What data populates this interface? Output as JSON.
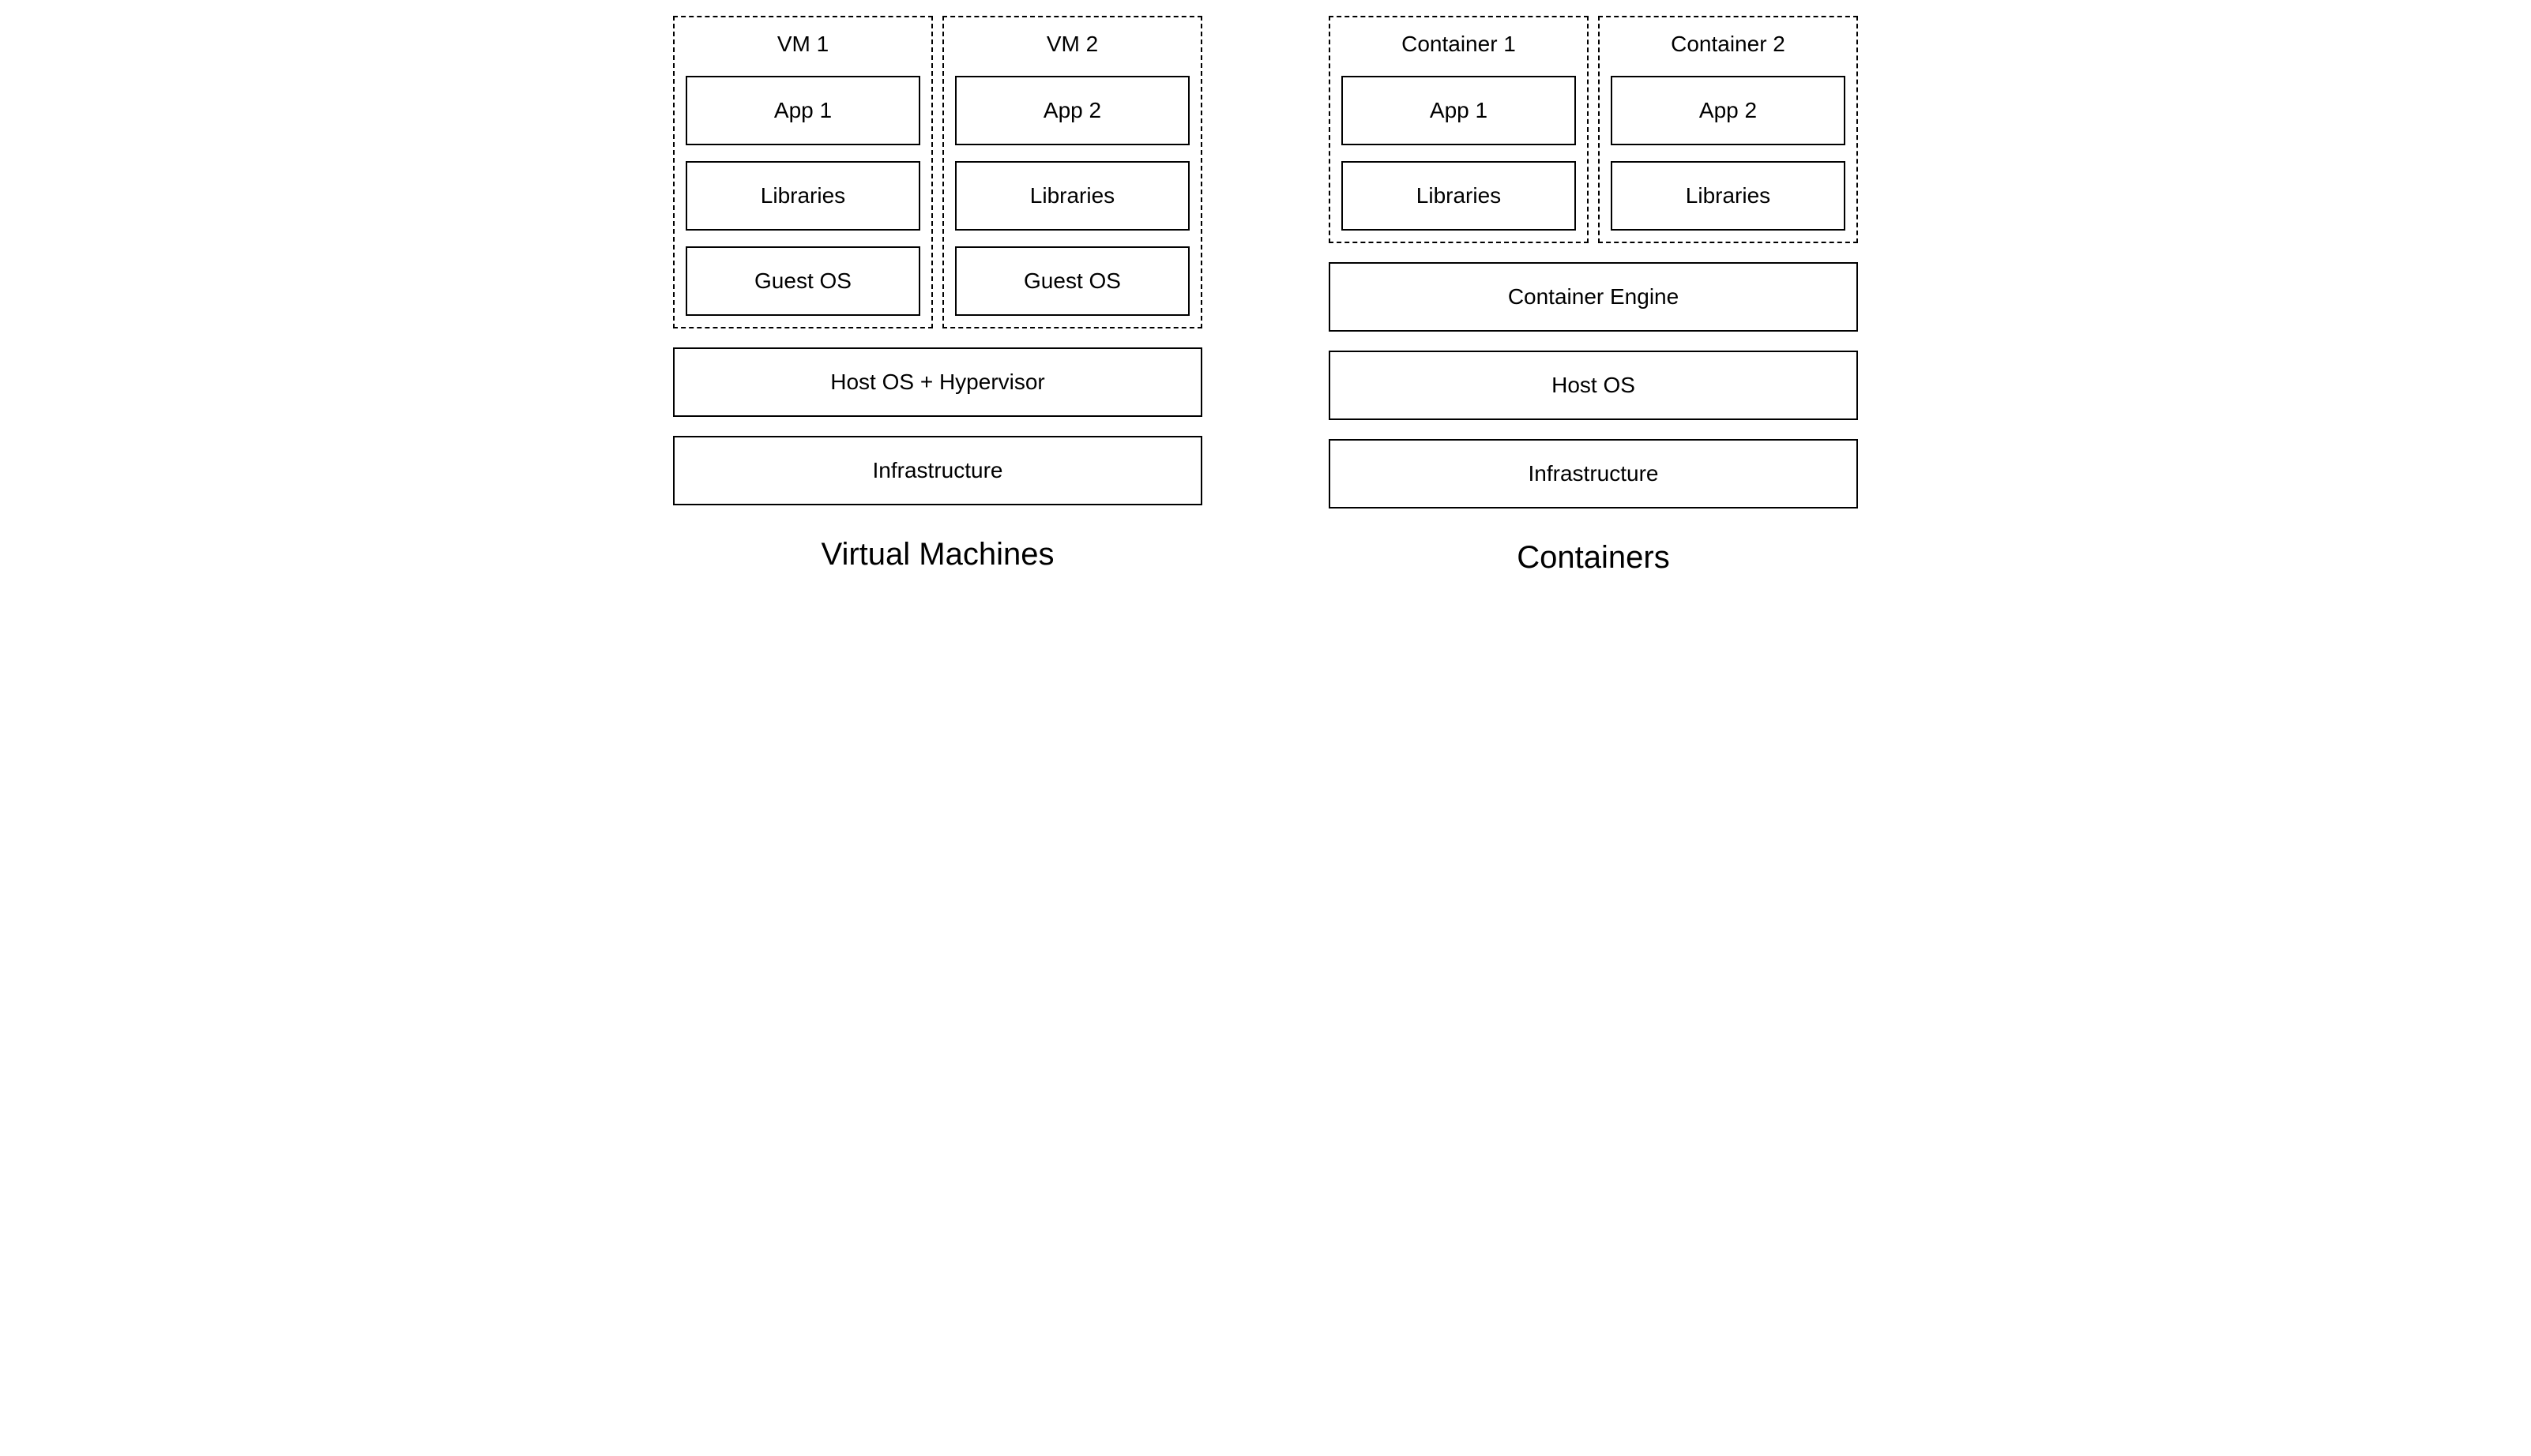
{
  "left": {
    "caption": "Virtual Machines",
    "dashed": [
      {
        "title": "VM 1",
        "boxes": [
          "App 1",
          "Libraries",
          "Guest OS"
        ]
      },
      {
        "title": "VM 2",
        "boxes": [
          "App 2",
          "Libraries",
          "Guest OS"
        ]
      }
    ],
    "base": [
      "Host OS + Hypervisor",
      "Infrastructure"
    ]
  },
  "right": {
    "caption": "Containers",
    "dashed": [
      {
        "title": "Container 1",
        "boxes": [
          "App 1",
          "Libraries"
        ]
      },
      {
        "title": "Container 2",
        "boxes": [
          "App 2",
          "Libraries"
        ]
      }
    ],
    "base": [
      "Container Engine",
      "Host OS",
      "Infrastructure"
    ]
  }
}
